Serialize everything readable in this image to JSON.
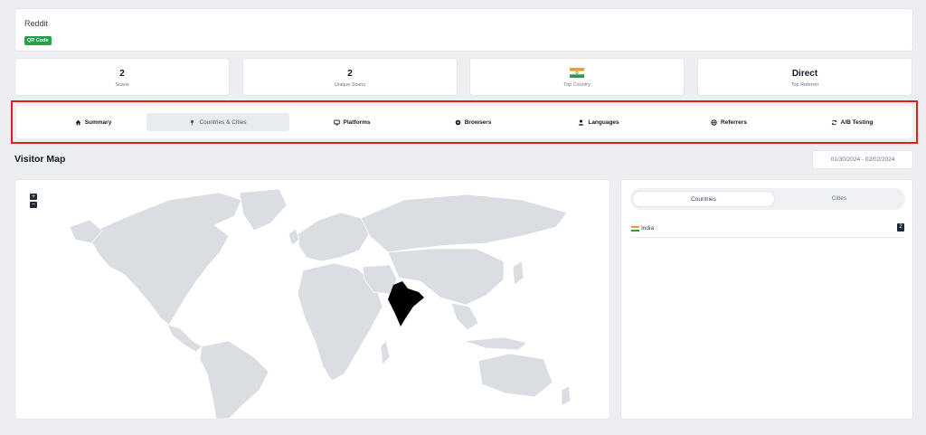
{
  "header": {
    "title": "Reddit",
    "badge": "QR Code"
  },
  "stats": [
    {
      "value": "2",
      "label": "Scans"
    },
    {
      "value": "2",
      "label": "Unique Scans"
    },
    {
      "value": "",
      "label": "Top Country",
      "flag": "india-flag-icon"
    },
    {
      "value": "Direct",
      "label": "Top Referrer"
    }
  ],
  "tabs": [
    {
      "label": "Summary",
      "icon": "home-icon"
    },
    {
      "label": "Countries & Cities",
      "icon": "map-pin-icon",
      "active": true
    },
    {
      "label": "Platforms",
      "icon": "monitor-icon"
    },
    {
      "label": "Browsers",
      "icon": "browser-icon"
    },
    {
      "label": "Languages",
      "icon": "user-icon"
    },
    {
      "label": "Referrers",
      "icon": "globe-icon"
    },
    {
      "label": "A/B Testing",
      "icon": "refresh-icon"
    }
  ],
  "section": {
    "title": "Visitor Map",
    "date_range": "01/30/2024 - 02/02/2024"
  },
  "map": {
    "zoom_in": "+",
    "zoom_out": "−",
    "highlight_color": "#000000",
    "land_color": "#dadde1"
  },
  "side": {
    "toggle": [
      "Countries",
      "Cities"
    ],
    "rows": [
      {
        "name": "India",
        "count": "2"
      }
    ]
  },
  "colors": {
    "badge": "#22a34a",
    "alert_outline": "#e11d1d"
  }
}
